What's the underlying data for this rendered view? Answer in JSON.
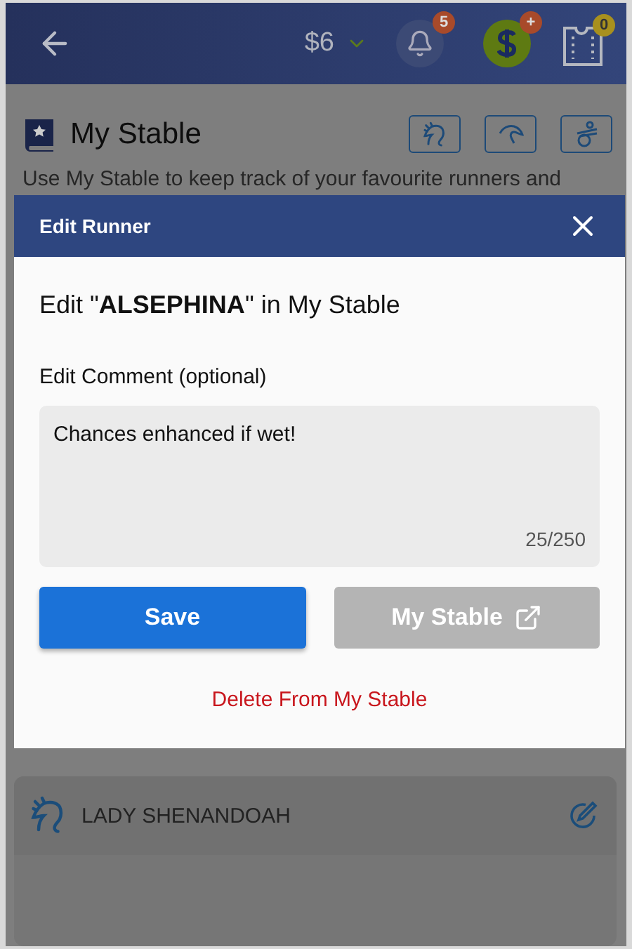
{
  "header": {
    "balance": "$6",
    "notification_count": "5",
    "wallet_badge": "+",
    "ticket_count": "0"
  },
  "page": {
    "title": "My Stable",
    "description": "Use My Stable to keep track of your favourite runners and"
  },
  "modal": {
    "title": "Edit Runner",
    "heading": "Edit \"**ALSEPHINA**\" in My Stable",
    "comment_label": "Edit Comment (optional)",
    "comment_value": "Chances enhanced if wet!",
    "counter": "25/250",
    "buttons": [
      {
        "label": "Save",
        "kind": "primary",
        "disabled": false
      },
      {
        "label": "My Stable",
        "kind": "external",
        "disabled": true
      }
    ],
    "delete_link": "Delete From My Stable"
  },
  "runners": [
    {
      "name": "LADY SHENANDOAH"
    }
  ]
}
